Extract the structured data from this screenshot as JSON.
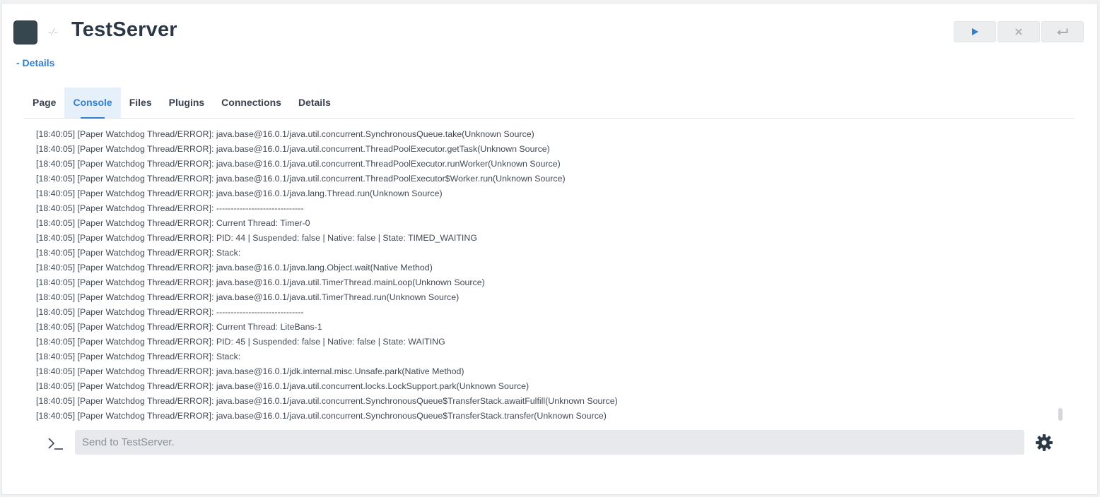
{
  "server": {
    "title": "TestServer",
    "status_mark": "-/-"
  },
  "actions": {
    "start_icon": "play-icon",
    "stop_icon": "close-icon",
    "restart_icon": "return-icon"
  },
  "details_toggle": "- Details",
  "tabs": [
    {
      "label": "Page"
    },
    {
      "label": "Console",
      "active": true
    },
    {
      "label": "Files"
    },
    {
      "label": "Plugins"
    },
    {
      "label": "Connections"
    },
    {
      "label": "Details"
    }
  ],
  "console": {
    "lines": [
      "[18:40:05] [Paper Watchdog Thread/ERROR]: java.base@16.0.1/java.util.concurrent.SynchronousQueue.take(Unknown Source)",
      "[18:40:05] [Paper Watchdog Thread/ERROR]: java.base@16.0.1/java.util.concurrent.ThreadPoolExecutor.getTask(Unknown Source)",
      "[18:40:05] [Paper Watchdog Thread/ERROR]: java.base@16.0.1/java.util.concurrent.ThreadPoolExecutor.runWorker(Unknown Source)",
      "[18:40:05] [Paper Watchdog Thread/ERROR]: java.base@16.0.1/java.util.concurrent.ThreadPoolExecutor$Worker.run(Unknown Source)",
      "[18:40:05] [Paper Watchdog Thread/ERROR]: java.base@16.0.1/java.lang.Thread.run(Unknown Source)",
      "[18:40:05] [Paper Watchdog Thread/ERROR]: ------------------------------",
      "[18:40:05] [Paper Watchdog Thread/ERROR]: Current Thread: Timer-0",
      "[18:40:05] [Paper Watchdog Thread/ERROR]: PID: 44 | Suspended: false | Native: false | State: TIMED_WAITING",
      "[18:40:05] [Paper Watchdog Thread/ERROR]: Stack:",
      "[18:40:05] [Paper Watchdog Thread/ERROR]: java.base@16.0.1/java.lang.Object.wait(Native Method)",
      "[18:40:05] [Paper Watchdog Thread/ERROR]: java.base@16.0.1/java.util.TimerThread.mainLoop(Unknown Source)",
      "[18:40:05] [Paper Watchdog Thread/ERROR]: java.base@16.0.1/java.util.TimerThread.run(Unknown Source)",
      "[18:40:05] [Paper Watchdog Thread/ERROR]: ------------------------------",
      "[18:40:05] [Paper Watchdog Thread/ERROR]: Current Thread: LiteBans-1",
      "[18:40:05] [Paper Watchdog Thread/ERROR]: PID: 45 | Suspended: false | Native: false | State: WAITING",
      "[18:40:05] [Paper Watchdog Thread/ERROR]: Stack:",
      "[18:40:05] [Paper Watchdog Thread/ERROR]: java.base@16.0.1/jdk.internal.misc.Unsafe.park(Native Method)",
      "[18:40:05] [Paper Watchdog Thread/ERROR]: java.base@16.0.1/java.util.concurrent.locks.LockSupport.park(Unknown Source)",
      "[18:40:05] [Paper Watchdog Thread/ERROR]: java.base@16.0.1/java.util.concurrent.SynchronousQueue$TransferStack.awaitFulfill(Unknown Source)",
      "[18:40:05] [Paper Watchdog Thread/ERROR]: java.base@16.0.1/java.util.concurrent.SynchronousQueue$TransferStack.transfer(Unknown Source)"
    ]
  },
  "command": {
    "value": "",
    "placeholder": "Send to TestServer.",
    "prompt_icon": "terminal-prompt-icon",
    "settings_icon": "gear-icon"
  },
  "colors": {
    "accent": "#2f80d1",
    "server_icon": "#37474f",
    "title": "#2c3845"
  }
}
